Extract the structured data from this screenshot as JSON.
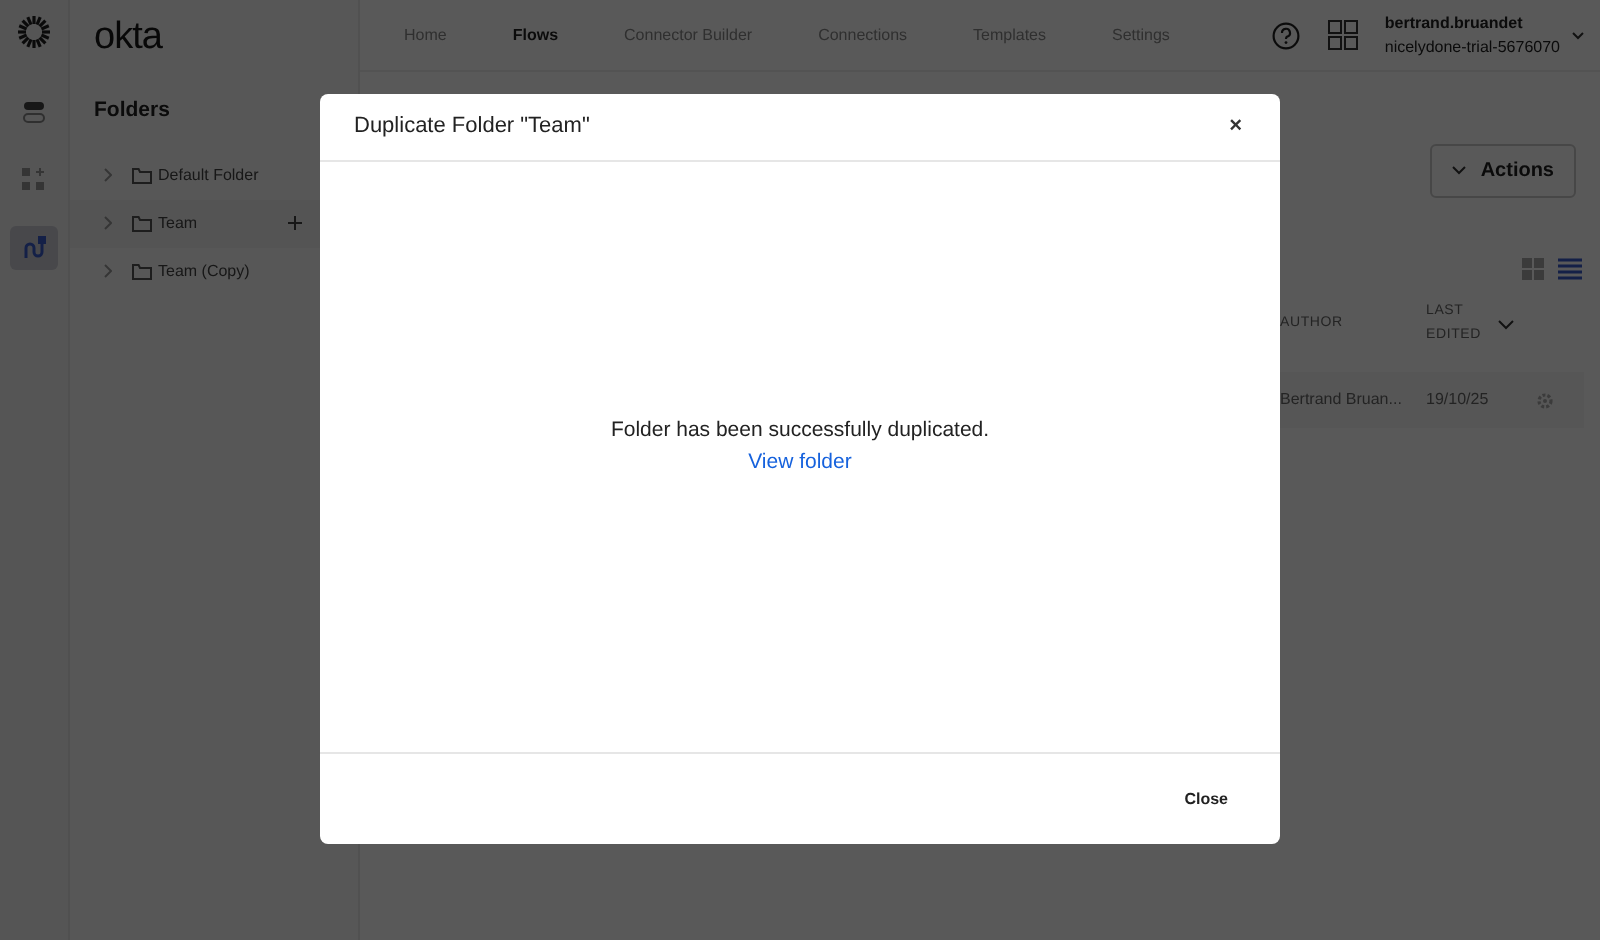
{
  "app": {
    "logo": "okta"
  },
  "rail": [
    {
      "kind": "toggle",
      "selected": false
    },
    {
      "kind": "apps",
      "selected": false
    },
    {
      "kind": "flows",
      "selected": true
    }
  ],
  "nav": {
    "tabs": [
      {
        "label": "Home",
        "selected": false
      },
      {
        "label": "Flows",
        "selected": true
      },
      {
        "label": "Connector Builder",
        "selected": false
      },
      {
        "label": "Connections",
        "selected": false
      },
      {
        "label": "Templates",
        "selected": false
      },
      {
        "label": "Settings",
        "selected": false
      }
    ],
    "user": {
      "name": "bertrand.bruandet",
      "org": "nicelydone-trial-5676070"
    }
  },
  "folders": {
    "title": "Folders",
    "items": [
      {
        "label": "Default Folder",
        "hovered": false
      },
      {
        "label": "Team",
        "hovered": true
      },
      {
        "label": "Team (Copy)",
        "hovered": false
      }
    ]
  },
  "actions": {
    "label": "Actions"
  },
  "view_toggle": [
    {
      "kind": "grid",
      "selected": false
    },
    {
      "kind": "list",
      "selected": true
    }
  ],
  "table": {
    "columns": [
      "AUTHOR",
      "LAST EDITED"
    ],
    "rows": [
      [
        "Bertrand Bruan...",
        "19/10/25"
      ]
    ]
  },
  "modal": {
    "title": "Duplicate Folder \"Team\"",
    "close": "×",
    "message": "Folder has been successfully duplicated.",
    "link": "View folder",
    "button": "Close"
  }
}
